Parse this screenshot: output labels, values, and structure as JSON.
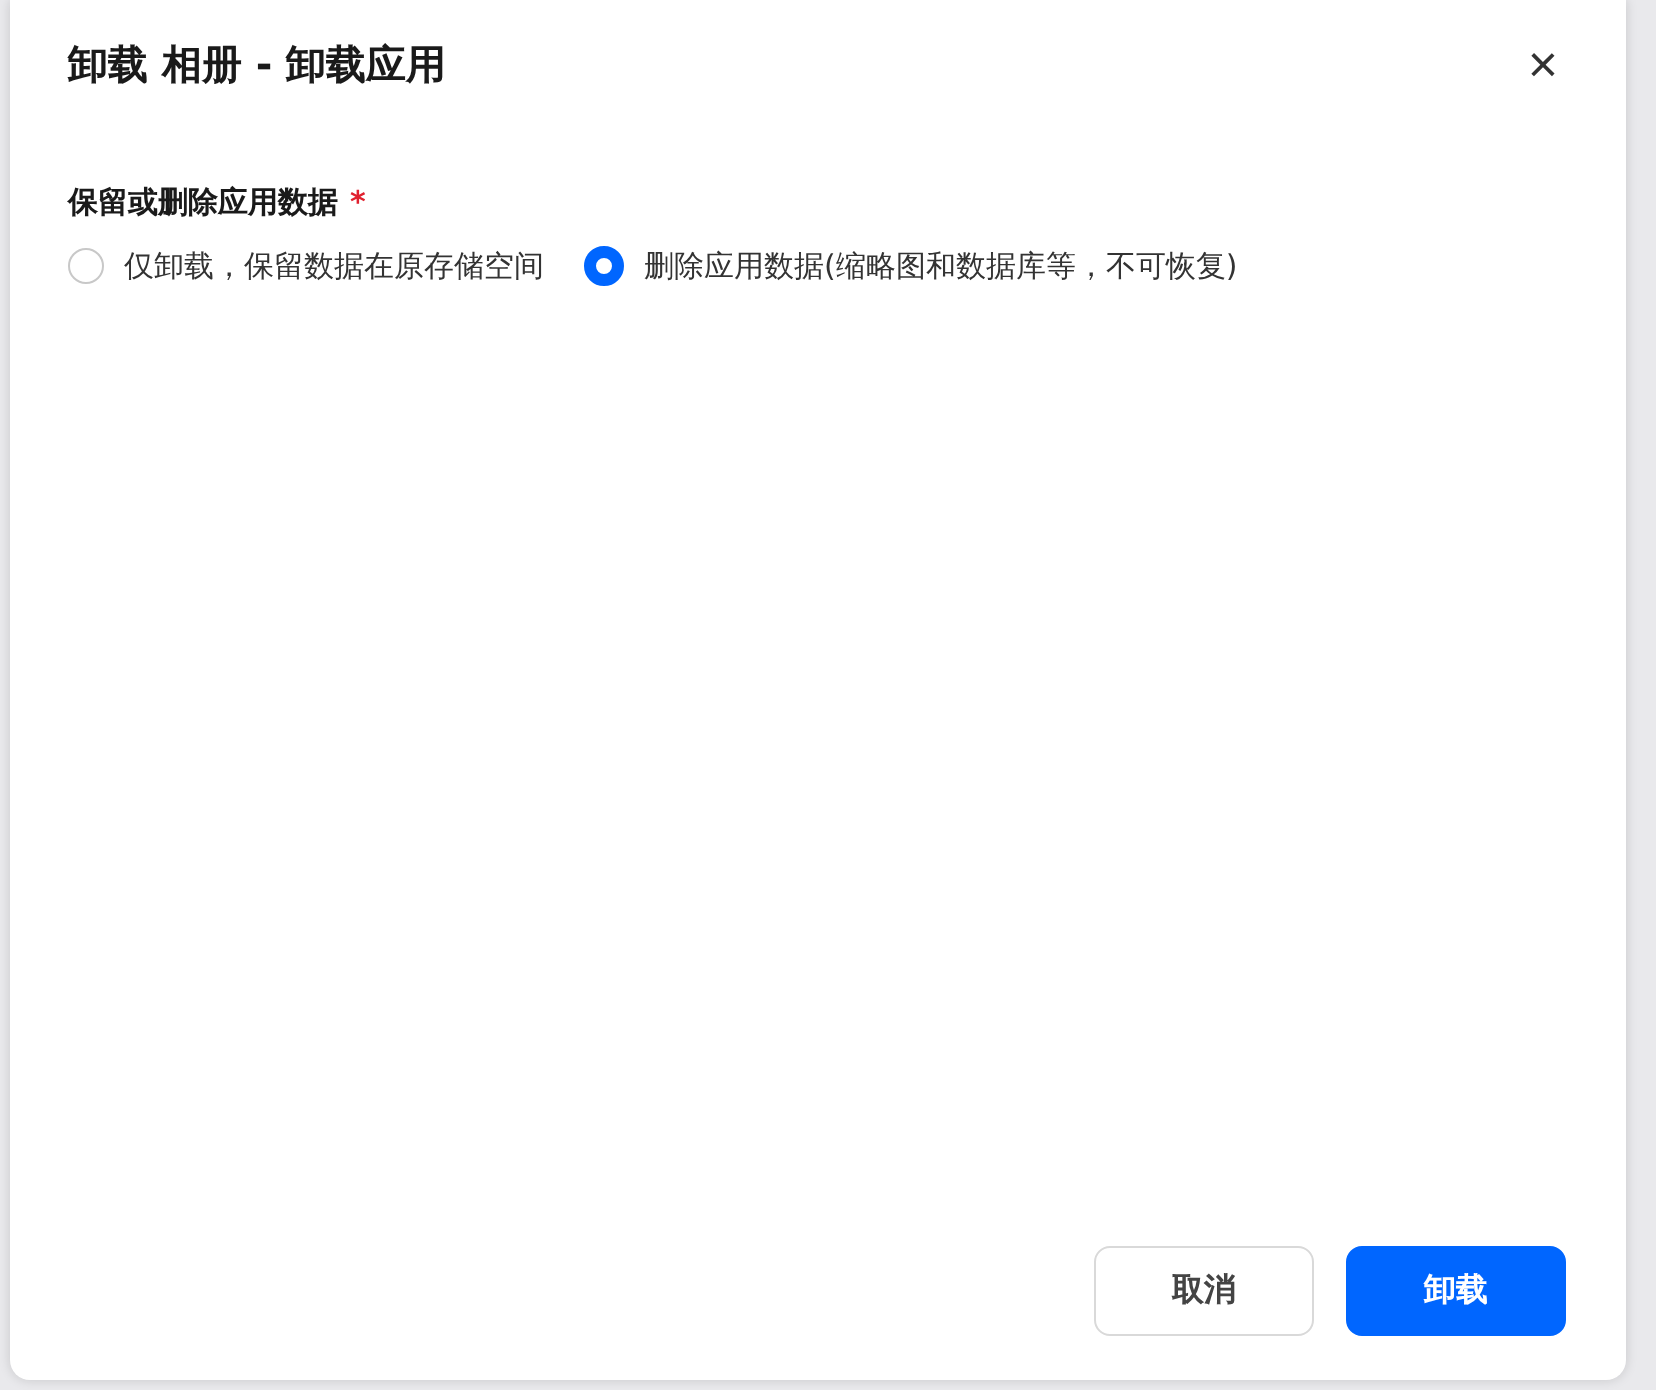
{
  "dialog": {
    "title": "卸载 相册 - 卸载应用",
    "close": "×"
  },
  "field": {
    "label": "保留或删除应用数据",
    "required": "*",
    "options": [
      {
        "label": "仅卸载，保留数据在原存储空间",
        "selected": false
      },
      {
        "label": "删除应用数据(缩略图和数据库等，不可恢复)",
        "selected": true
      }
    ]
  },
  "buttons": [
    {
      "kind": "secondary",
      "label": "取消"
    },
    {
      "kind": "primary",
      "label": "卸载"
    }
  ]
}
